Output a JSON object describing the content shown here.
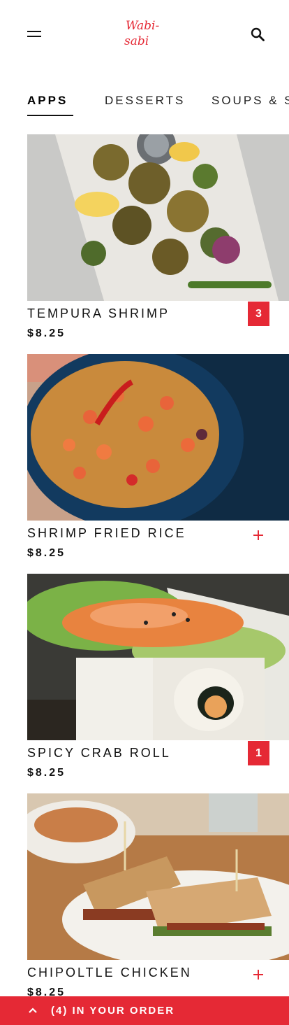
{
  "app": {
    "logo_text_1": "Wabi-",
    "logo_text_2": "sabi",
    "brand_color": "#e52935"
  },
  "tabs": [
    {
      "label": "APPS",
      "active": true
    },
    {
      "label": "DESSERTS",
      "active": false
    },
    {
      "label": "SOUPS & S",
      "active": false
    }
  ],
  "items": [
    {
      "name": "TEMPURA SHRIMP",
      "price": "$8.25",
      "quantity": "3"
    },
    {
      "name": "SHRIMP FRIED RICE",
      "price": "$8.25",
      "quantity": null
    },
    {
      "name": "SPICY CRAB ROLL",
      "price": "$8.25",
      "quantity": "1"
    },
    {
      "name": "CHIPOLTLE CHICKEN",
      "price": "$8.25",
      "quantity": null
    }
  ],
  "order_bar": {
    "label": "(4) IN YOUR ORDER"
  },
  "icons": {
    "menu": "menu-icon",
    "search": "search-icon",
    "add": "plus-icon",
    "expand": "chevron-up-icon"
  }
}
